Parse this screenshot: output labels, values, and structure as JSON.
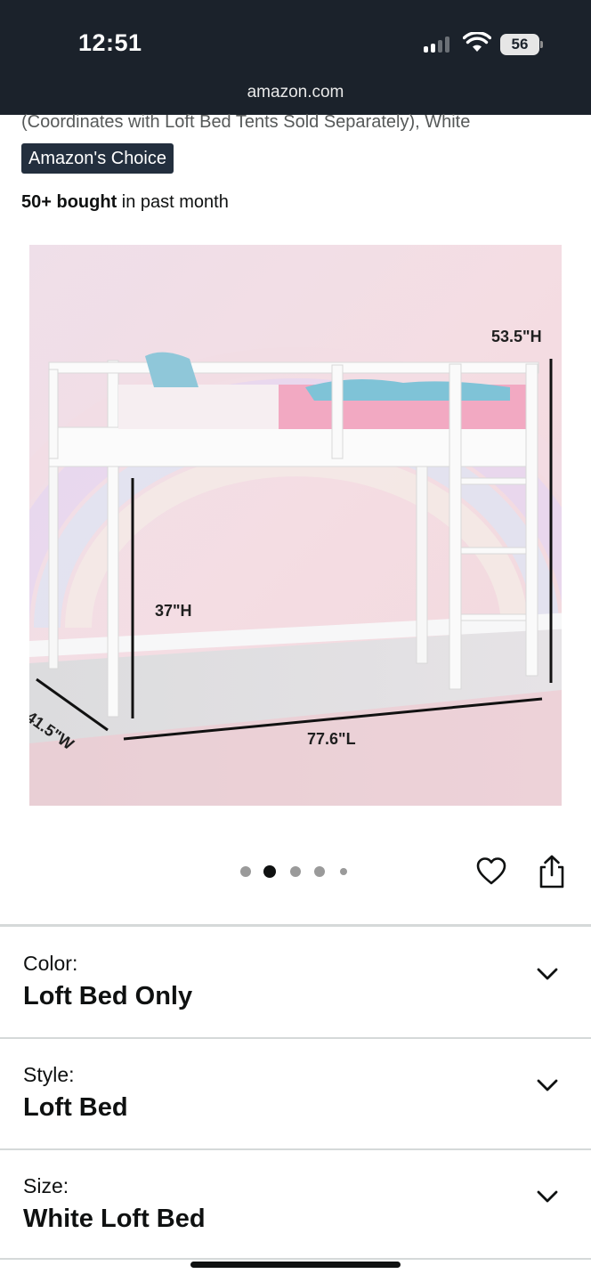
{
  "status_bar": {
    "time": "12:51",
    "battery": "56"
  },
  "browser": {
    "url": "amazon.com"
  },
  "product": {
    "subtitle": "(Coordinates with Loft Bed Tents Sold Separately), White",
    "badge": "Amazon's Choice",
    "bought_bold": "50+ bought",
    "bought_rest": " in past month"
  },
  "image": {
    "dimensions": {
      "height_total": "53.5\"H",
      "height_under": "37\"H",
      "width": "41.5\"W",
      "length": "77.6\"L"
    },
    "carousel": {
      "count": 5,
      "active_index": 1
    }
  },
  "actions": {
    "wishlist_icon": "heart-icon",
    "share_icon": "share-icon"
  },
  "variations": [
    {
      "label": "Color:",
      "value": "Loft Bed Only"
    },
    {
      "label": "Style:",
      "value": "Loft Bed"
    },
    {
      "label": "Size:",
      "value": "White Loft Bed"
    }
  ],
  "colors": {
    "topbar": "#1b222b",
    "badge": "#232f3e",
    "divider": "#d5d9d9"
  }
}
